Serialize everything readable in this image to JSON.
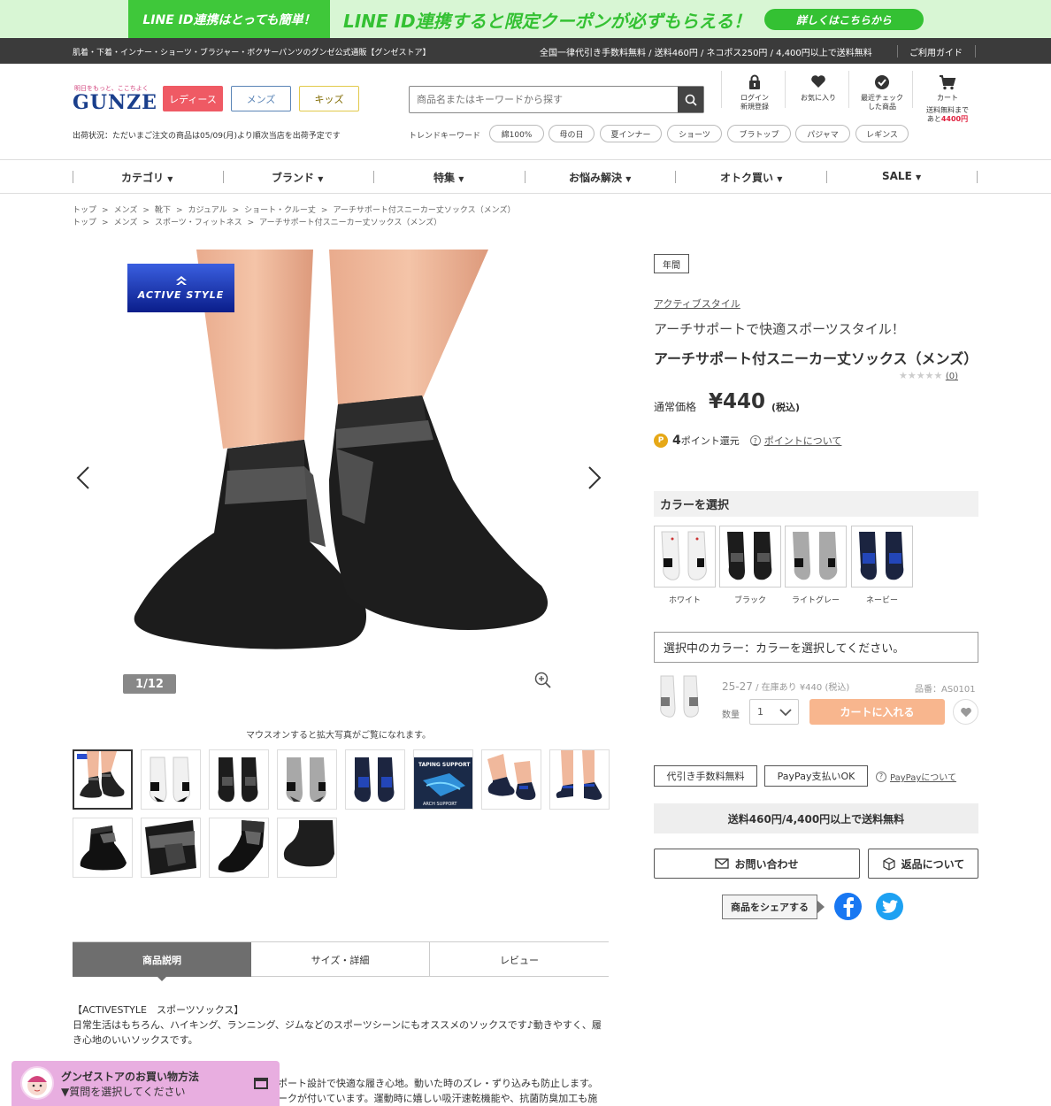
{
  "banner": {
    "left_text": "LINE ID連携はとっても簡単！",
    "message": "LINE ID連携すると限定クーポンが必ずもらえる！",
    "button": "詳しくはこちらから"
  },
  "topbar": {
    "left": "肌着・下着・インナー・ショーツ・ブラジャー・ボクサーパンツのグンゼ公式通販【グンゼストア】",
    "right": "全国一律代引き手数料無料 / 送料460円 / ネコポス250円 / 4,400円以上で送料無料",
    "guide": "ご利用ガイド"
  },
  "header": {
    "logo_tagline": "明日をもっと、ここちよく",
    "logo": "GUNZE",
    "cat_ladies": "レディース",
    "cat_mens": "メンズ",
    "cat_kids": "キッズ",
    "ship_status": "出荷状況：ただいまご注文の商品は05/09(月)より順次当店を出荷予定です",
    "search_placeholder": "商品名またはキーワードから探す",
    "trend_label": "トレンドキーワード",
    "trend_keywords": [
      "綿100%",
      "母の日",
      "夏インナー",
      "ショーツ",
      "ブラトップ",
      "パジャマ",
      "レギンス"
    ],
    "icons": {
      "login_1": "ログイン",
      "login_2": "新規登録",
      "fav": "お気に入り",
      "recent_1": "最近チェック",
      "recent_2": "した商品",
      "cart": "カート",
      "cart_note_1": "送料無料まで",
      "cart_note_2": "あと",
      "cart_note_amount": "4400円"
    }
  },
  "nav": [
    "カテゴリ",
    "ブランド",
    "特集",
    "お悩み解決",
    "オトク買い",
    "SALE"
  ],
  "breadcrumbs": [
    [
      "トップ",
      "メンズ",
      "靴下",
      "カジュアル",
      "ショート・クルー丈",
      "アーチサポート付スニーカー丈ソックス（メンズ）"
    ],
    [
      "トップ",
      "メンズ",
      "スポーツ・フィットネス",
      "アーチサポート付スニーカー丈ソックス（メンズ）"
    ]
  ],
  "gallery": {
    "badge": "ACTIVE STYLE",
    "counter": "1/12",
    "hover_note": "マウスオンすると拡大写真がご覧になれます。",
    "taping_title": "TAPING SUPPORT",
    "arch_label": "ARCH SUPPORT"
  },
  "tabs": [
    "商品説明",
    "サイズ・詳細",
    "レビュー"
  ],
  "description": {
    "heading": "【ACTIVESTYLE　スポーツソックス】",
    "body": "日常生活はもちろん、ハイキング、ランニング、ジムなどのスポーツシーンにもオススメのソックスです♪動きやすく、履き心地のいいソックスです。",
    "line3": "ポート設計で快適な履き心地。動いた時のズレ・ずり込みも防止します。",
    "line4": "ークが付いています。運動時に嬉しい吸汗速乾機能や、抗菌防臭加工も施"
  },
  "chat": {
    "title": "グンゼストアのお買い物方法",
    "subtitle": "▼質問を選択してください"
  },
  "product": {
    "season": "年間",
    "brand": "アクティブスタイル",
    "catch": "アーチサポートで快適スポーツスタイル！",
    "name": "アーチサポート付スニーカー丈ソックス（メンズ）",
    "stars": "★★★★★",
    "review_count": "(0)",
    "price_label": "通常価格",
    "price": "¥440",
    "tax": "(税込)",
    "points_icon": "P",
    "points_value": "4",
    "points_unit": "ポイント還元",
    "points_link": "ポイントについて",
    "color_heading": "カラーを選択",
    "colors": [
      "ホワイト",
      "ブラック",
      "ライトグレー",
      "ネービー"
    ],
    "selected_color": "選択中のカラー：カラーを選択してください。",
    "size": "25-27",
    "stock": "/ 在庫あり",
    "item_price": "¥440 (税込)",
    "code": "品番：AS0101",
    "qty_label": "数量",
    "qty": "1",
    "cart_button": "カートに入れる",
    "tag_cod": "代引き手数料無料",
    "tag_paypay": "PayPay支払いOK",
    "paypay_link": "PayPayについて",
    "shipping": "送料460円/4,400円以上で送料無料",
    "contact": "お問い合わせ",
    "returns": "返品について",
    "share": "商品をシェアする"
  },
  "colors": {
    "line_green": "#34c133",
    "ladies": "#ef5a64",
    "cart_btn": "#f8b68e",
    "facebook": "#1877f2",
    "twitter": "#1da1f2"
  }
}
